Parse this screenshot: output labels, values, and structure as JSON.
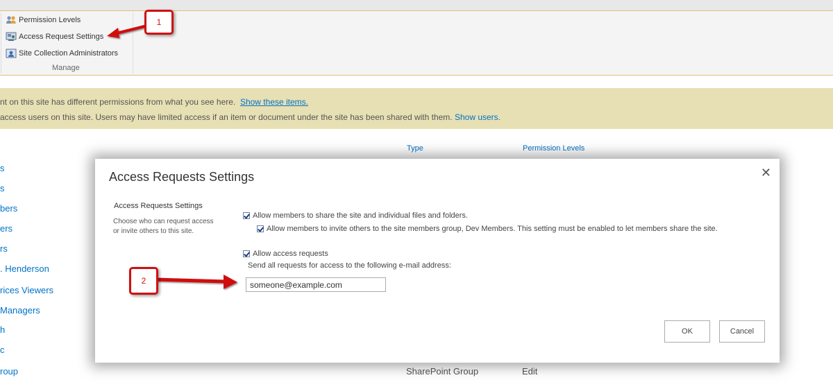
{
  "ribbon": {
    "items": [
      {
        "label": "Permission Levels",
        "icon": "people-icon"
      },
      {
        "label": "Access Request Settings",
        "icon": "access-request-icon"
      },
      {
        "label": "Site Collection Administrators",
        "icon": "admin-icon"
      }
    ],
    "group_label": "Manage"
  },
  "warning": {
    "line1_text": "nt on this site has different permissions from what you see here.",
    "line1_link": "Show these items.",
    "line2_text": "access users on this site. Users may have limited access if an item or document under the site has been shared with them.",
    "line2_link": "Show users."
  },
  "list": {
    "columns": [
      "Type",
      "Permission Levels"
    ],
    "partial_names": [
      "s",
      "s",
      "bers",
      "ers",
      "rs",
      ". Henderson",
      "rices Viewers",
      " Managers",
      "h",
      "c",
      "roup"
    ],
    "visible_row": {
      "type": "SharePoint Group",
      "permission": "Edit"
    }
  },
  "dialog": {
    "title": "Access Requests Settings",
    "close_symbol": "✕",
    "section_title": "Access Requests Settings",
    "section_desc": "Choose who can request access or invite others to this site.",
    "options": [
      {
        "label": "Allow members to share the site and individual files and folders.",
        "checked": true
      },
      {
        "label": "Allow members to invite others to the site members group, Dev Members. This setting must be enabled to let members share the site.",
        "checked": true
      },
      {
        "label": "Allow access requests",
        "checked": true
      }
    ],
    "email_label": "Send all requests for access to the following e-mail address:",
    "email_value": "someone@example.com",
    "ok_label": "OK",
    "cancel_label": "Cancel"
  },
  "callouts": [
    "1",
    "2"
  ],
  "colors": {
    "accent": "#0072c6",
    "callout": "#d01010",
    "warning_bg": "#e7e0b4"
  }
}
